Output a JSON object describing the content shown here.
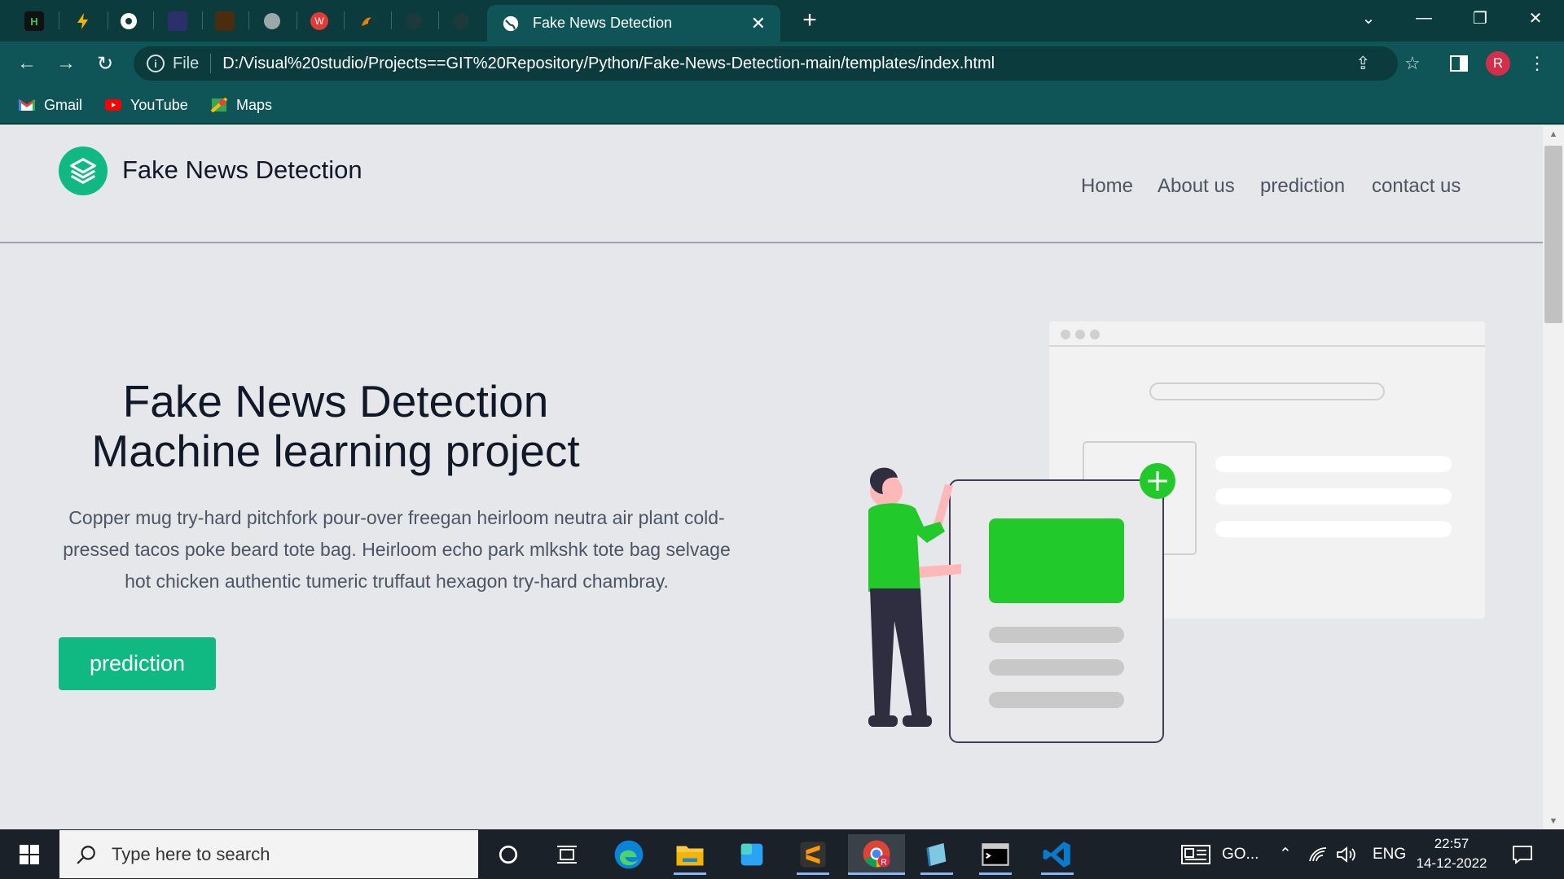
{
  "browser": {
    "active_tab_title": "Fake News Detection",
    "address_prefix": "File",
    "url": "D:/Visual%20studio/Projects==GIT%20Repository/Python/Fake-News-Detection-main/templates/index.html",
    "profile_initial": "R",
    "bookmarks": [
      {
        "label": "Gmail",
        "icon": "gmail-icon"
      },
      {
        "label": "YouTube",
        "icon": "youtube-icon"
      },
      {
        "label": "Maps",
        "icon": "maps-icon"
      }
    ]
  },
  "site": {
    "brand": "Fake News Detection",
    "nav": [
      "Home",
      "About us",
      "prediction",
      "contact us"
    ],
    "hero_title_line1": "Fake News Detection",
    "hero_title_line2": "Machine learning project",
    "hero_text": "Copper mug try-hard pitchfork pour-over freegan heirloom neutra air plant cold-pressed tacos poke beard tote bag. Heirloom echo park mlkshk tote bag selvage hot chicken authentic tumeric truffaut hexagon try-hard chambray.",
    "cta_label": "prediction",
    "accent_color": "#10b981",
    "illustration_accent": "#22c92a"
  },
  "taskbar": {
    "search_placeholder": "Type here to search",
    "news_widget": "GO...",
    "language": "ENG",
    "time": "22:57",
    "date": "14-12-2022"
  }
}
